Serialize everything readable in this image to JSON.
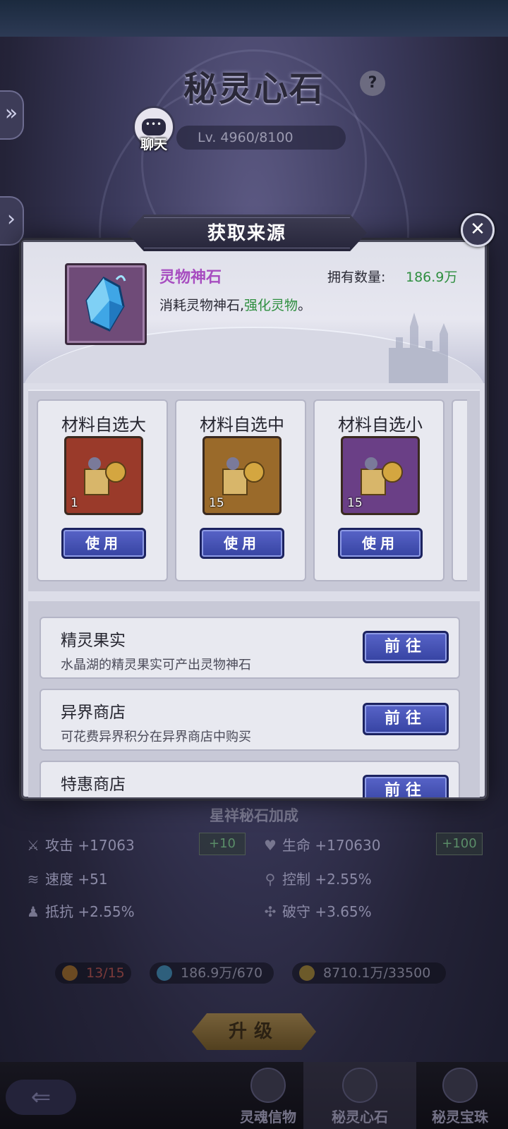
{
  "background": {
    "title": "秘灵心石",
    "help_icon_text": "?",
    "chat_label": "聊天",
    "level_text": "Lv. 4960/8100",
    "stats_title": "星祥秘石加成",
    "stats": [
      {
        "label": "攻击 +17063",
        "icon": "sword-icon"
      },
      {
        "label": "+10"
      },
      {
        "label": "生命 +170630",
        "icon": "heart-icon"
      },
      {
        "label": "+100"
      },
      {
        "label": "速度 +51",
        "icon": "boot-icon"
      },
      {
        "label": "控制 +2.55%",
        "icon": "control-icon"
      },
      {
        "label": "抵抗 +2.55%",
        "icon": "resist-icon"
      },
      {
        "label": "破守 +3.65%",
        "icon": "break-icon"
      }
    ],
    "resources": [
      {
        "text": "13/15",
        "icon": "token-icon"
      },
      {
        "text": "186.9万/670",
        "icon": "crystal-icon"
      },
      {
        "text": "8710.1万/33500",
        "icon": "coin-icon"
      }
    ],
    "upgrade_label": "升级",
    "nav_tabs": [
      "灵魂信物",
      "秘灵心石",
      "秘灵宝珠"
    ]
  },
  "modal": {
    "title": "获取来源",
    "close_icon": "close-icon",
    "item": {
      "name": "灵物神石",
      "owned_label": "拥有数量:",
      "owned_value": "186.9万",
      "desc_prefix": "消耗灵物神石,",
      "desc_highlight": "强化灵物",
      "desc_suffix": "。"
    },
    "materials": [
      {
        "title": "材料自选大",
        "count": "1",
        "use_label": "使用",
        "frame_color": "#9a3a2a"
      },
      {
        "title": "材料自选中",
        "count": "15",
        "use_label": "使用",
        "frame_color": "#9a6a2a"
      },
      {
        "title": "材料自选小",
        "count": "15",
        "use_label": "使用",
        "frame_color": "#6a3f86"
      }
    ],
    "sources": [
      {
        "title": "精灵果实",
        "desc": "水晶湖的精灵果实可产出灵物神石",
        "go_label": "前往"
      },
      {
        "title": "异界商店",
        "desc": "可花费异界积分在异界商店中购买",
        "go_label": "前往"
      },
      {
        "title": "特惠商店",
        "desc": "",
        "go_label": "前往"
      }
    ]
  }
}
